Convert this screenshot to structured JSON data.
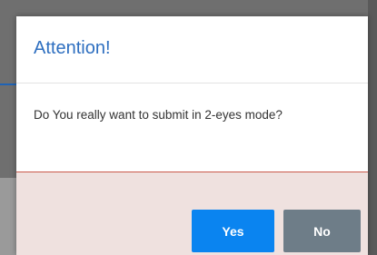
{
  "dialog": {
    "title": "Attention!",
    "message": "Do You really want to submit in 2-eyes mode?",
    "buttons": {
      "yes_label": "Yes",
      "no_label": "No"
    }
  },
  "colors": {
    "title": "#2e6fc0",
    "yes_button": "#0a84f0",
    "no_button": "#6e7d88",
    "footer_background": "#efe1df",
    "footer_border": "#c9584a",
    "overlay": "#6f6f6f"
  }
}
